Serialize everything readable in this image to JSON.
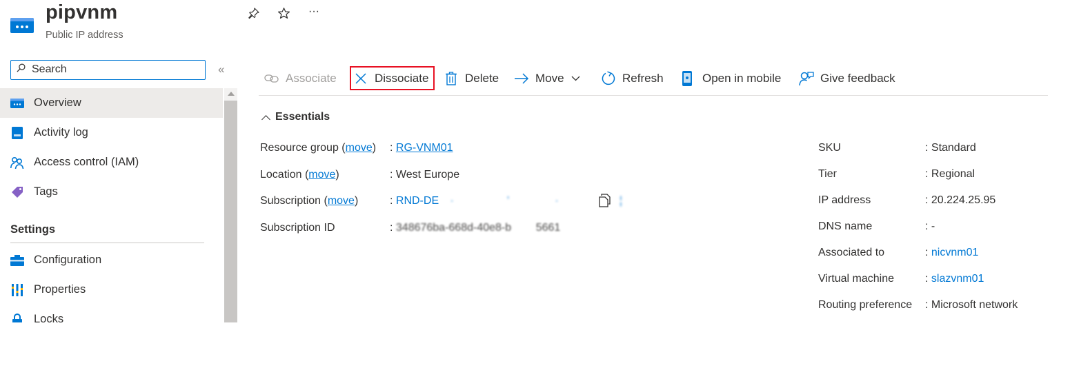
{
  "header": {
    "title": "pipvnm",
    "subtitle": "Public IP address",
    "resource_icon": "public-ip-icon",
    "pin_icon": "pin-icon",
    "favorite_icon": "star-icon",
    "more_icon": "ellipsis-icon",
    "more_glyph": "···"
  },
  "sidebar": {
    "search_placeholder": "Search",
    "collapse_glyph": "«",
    "items": [
      {
        "label": "Overview",
        "icon": "overview-icon",
        "active": true
      },
      {
        "label": "Activity log",
        "icon": "activity-log-icon"
      },
      {
        "label": "Access control (IAM)",
        "icon": "iam-people-icon"
      },
      {
        "label": "Tags",
        "icon": "tag-icon"
      }
    ],
    "settings_header": "Settings",
    "settings_items": [
      {
        "label": "Configuration",
        "icon": "configuration-icon"
      },
      {
        "label": "Properties",
        "icon": "properties-icon"
      },
      {
        "label": "Locks",
        "icon": "lock-icon"
      }
    ]
  },
  "toolbar": {
    "associate": "Associate",
    "dissociate": "Dissociate",
    "delete": "Delete",
    "move": "Move",
    "refresh": "Refresh",
    "open_in_mobile": "Open in mobile",
    "give_feedback": "Give feedback"
  },
  "essentials": {
    "header": "Essentials",
    "move_link": "move",
    "left": {
      "resource_group_label_pre": "Resource group (",
      "resource_group_label_post": ")",
      "resource_group_value": "RG-VNM01",
      "location_label_pre": "Location (",
      "location_label_post": ")",
      "location_value": "West Europe",
      "subscription_label_pre": "Subscription (",
      "subscription_label_post": ")",
      "subscription_value": "RND-DE",
      "subscription_id_label": "Subscription ID",
      "subscription_id_value": "348676ba-668d-40e8-b",
      "subscription_id_tail": "5661"
    },
    "right": [
      {
        "label": "SKU",
        "value": "Standard",
        "link": false
      },
      {
        "label": "Tier",
        "value": "Regional",
        "link": false
      },
      {
        "label": "IP address",
        "value": "20.224.25.95",
        "link": false
      },
      {
        "label": "DNS name",
        "value": "-",
        "link": false
      },
      {
        "label": "Associated to",
        "value": "nicvnm01",
        "link": true
      },
      {
        "label": "Virtual machine",
        "value": "slazvnm01",
        "link": true
      },
      {
        "label": "Routing preference",
        "value": "Microsoft network",
        "link": false
      }
    ],
    "separator": ": "
  },
  "colors": {
    "accent": "#0078d4",
    "highlight_border": "#e81123",
    "active_nav_bg": "#edebe9"
  }
}
